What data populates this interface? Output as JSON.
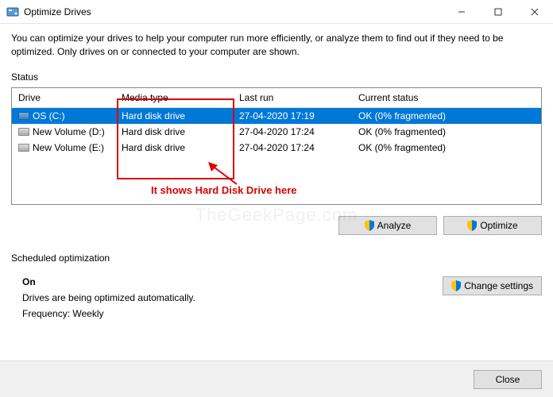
{
  "titlebar": {
    "title": "Optimize Drives"
  },
  "description": "You can optimize your drives to help your computer run more efficiently, or analyze them to find out if they need to be optimized. Only drives on or connected to your computer are shown.",
  "status_label": "Status",
  "columns": {
    "drive": "Drive",
    "media": "Media type",
    "last": "Last run",
    "status": "Current status"
  },
  "drives": [
    {
      "name": "OS (C:)",
      "media": "Hard disk drive",
      "last": "27-04-2020 17:19",
      "status": "OK (0% fragmented)",
      "selected": true
    },
    {
      "name": "New Volume (D:)",
      "media": "Hard disk drive",
      "last": "27-04-2020 17:24",
      "status": "OK (0% fragmented)",
      "selected": false
    },
    {
      "name": "New Volume (E:)",
      "media": "Hard disk drive",
      "last": "27-04-2020 17:24",
      "status": "OK (0% fragmented)",
      "selected": false
    }
  ],
  "buttons": {
    "analyze": "Analyze",
    "optimize": "Optimize",
    "change_settings": "Change settings",
    "close": "Close"
  },
  "scheduled": {
    "label": "Scheduled optimization",
    "on": "On",
    "desc": "Drives are being optimized automatically.",
    "freq": "Frequency: Weekly"
  },
  "annotation": "It shows Hard Disk Drive here"
}
